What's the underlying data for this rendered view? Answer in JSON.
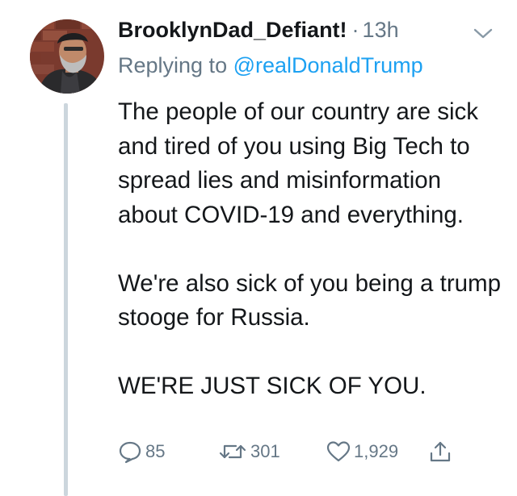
{
  "tweet": {
    "display_name": "BrooklynDad_Defiant!",
    "separator": "·",
    "timestamp": "13h",
    "replying_prefix": "Replying to ",
    "replying_to": "@realDonaldTrump",
    "paragraphs": [
      "The people of our country are sick and tired of you using Big Tech to spread lies and misinformation about COVID-19 and everything.",
      "We're also sick of you being a trump stooge for Russia.",
      "WE'RE JUST SICK OF YOU."
    ],
    "actions": {
      "reply_count": "85",
      "retweet_count": "301",
      "like_count": "1,929"
    }
  },
  "icons": {
    "more": "chevron-down-icon",
    "reply": "reply-icon",
    "retweet": "retweet-icon",
    "like": "heart-icon",
    "share": "share-icon"
  },
  "colors": {
    "text": "#14171a",
    "secondary": "#657786",
    "link": "#1da1f2",
    "thread_line": "#ccd6dd"
  }
}
